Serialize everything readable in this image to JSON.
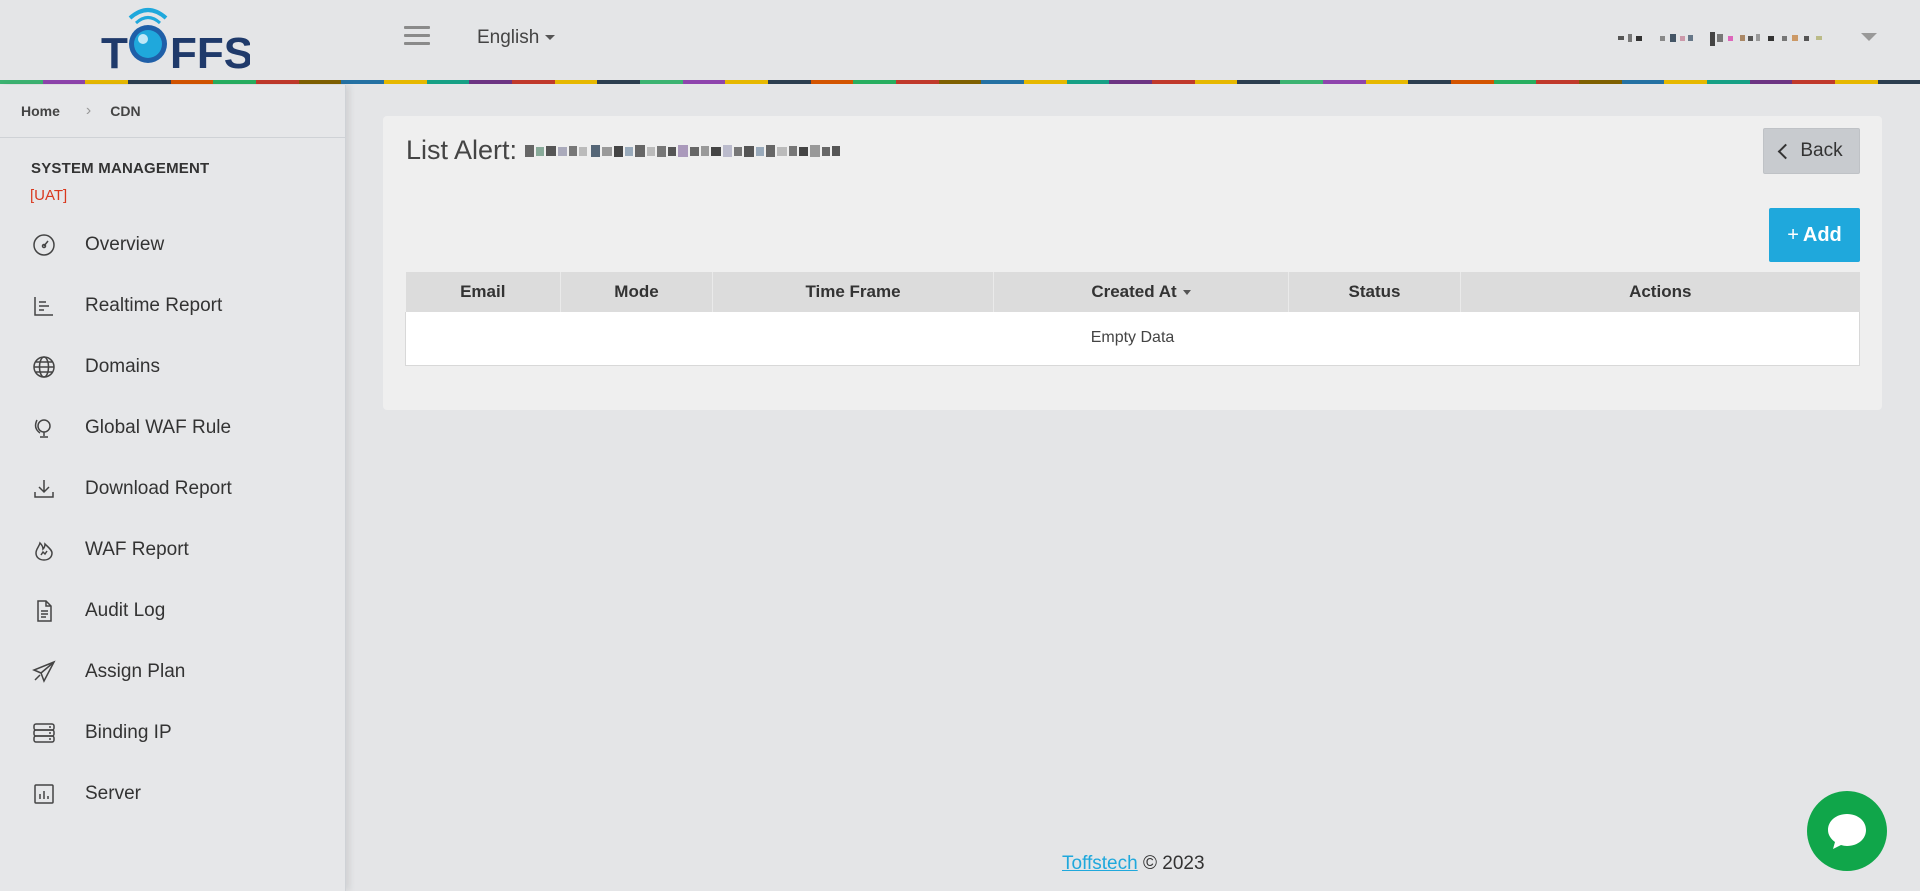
{
  "header": {
    "logo_text": "TOFFS",
    "language": "English",
    "rainbow_colors": [
      "#3cb371",
      "#8e44ad",
      "#e6b800",
      "#2c3e50",
      "#d35400",
      "#27ae60",
      "#c0392b",
      "#7f6000",
      "#2471a3",
      "#e6b800",
      "#16a085",
      "#6c3483",
      "#c0392b",
      "#e6b800",
      "#2c3e50"
    ]
  },
  "breadcrumb": {
    "home": "Home",
    "current": "CDN"
  },
  "sidebar": {
    "section_title": "SYSTEM MANAGEMENT",
    "env_badge": "[UAT]",
    "items": [
      {
        "label": "Overview",
        "icon": "dashboard-gauge-icon"
      },
      {
        "label": "Realtime Report",
        "icon": "bar-chart-icon"
      },
      {
        "label": "Domains",
        "icon": "globe-icon"
      },
      {
        "label": "Global WAF Rule",
        "icon": "globe-stand-icon"
      },
      {
        "label": "Download Report",
        "icon": "download-icon"
      },
      {
        "label": "WAF Report",
        "icon": "fire-icon"
      },
      {
        "label": "Audit Log",
        "icon": "document-icon"
      },
      {
        "label": "Assign Plan",
        "icon": "paper-plane-icon"
      },
      {
        "label": "Binding IP",
        "icon": "server-stack-icon"
      },
      {
        "label": "Server",
        "icon": "stats-chart-icon"
      }
    ]
  },
  "main": {
    "title": "List Alert:",
    "back_label": "Back",
    "add_label": "Add",
    "table": {
      "columns": [
        "Email",
        "Mode",
        "Time Frame",
        "Created At",
        "Status",
        "Actions"
      ],
      "empty_text": "Empty Data"
    }
  },
  "footer": {
    "link": "Toffstech",
    "copyright": "© 2023"
  },
  "colors": {
    "accent": "#1fa8dc",
    "chat": "#10a64a",
    "uat": "#d9381e"
  }
}
